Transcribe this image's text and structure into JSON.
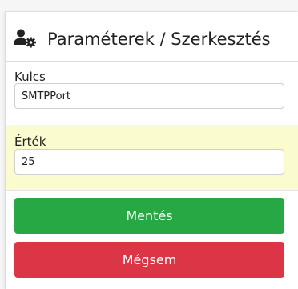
{
  "header": {
    "icon": "user-gear-icon",
    "title": "Paraméterek / Szerkesztés"
  },
  "form": {
    "key": {
      "label": "Kulcs",
      "value": "SMTPPort"
    },
    "value": {
      "label": "Érték",
      "value": "25",
      "highlight_color": "#fbfbd0"
    }
  },
  "actions": {
    "save_label": "Mentés",
    "save_color": "#28a745",
    "cancel_label": "Mégsem",
    "cancel_color": "#dc3545"
  }
}
